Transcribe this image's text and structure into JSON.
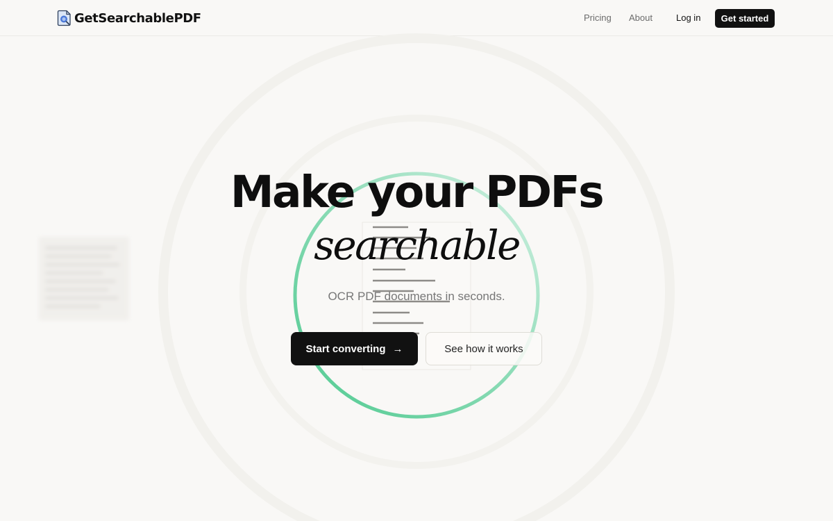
{
  "header": {
    "brand": "GetSearchablePDF",
    "nav": {
      "pricing": "Pricing",
      "about": "About",
      "login": "Log in",
      "cta": "Get started"
    }
  },
  "hero": {
    "title_line1": "Make your PDFs",
    "title_line2": "searchable",
    "subtitle": "OCR PDF documents in seconds.",
    "primary_button": "Start converting",
    "primary_button_icon": "arrow-right-icon",
    "secondary_button": "See how it works"
  },
  "colors": {
    "accent_green": "#5ccf9c",
    "button_dark": "#111111",
    "background": "#f9f8f6"
  }
}
